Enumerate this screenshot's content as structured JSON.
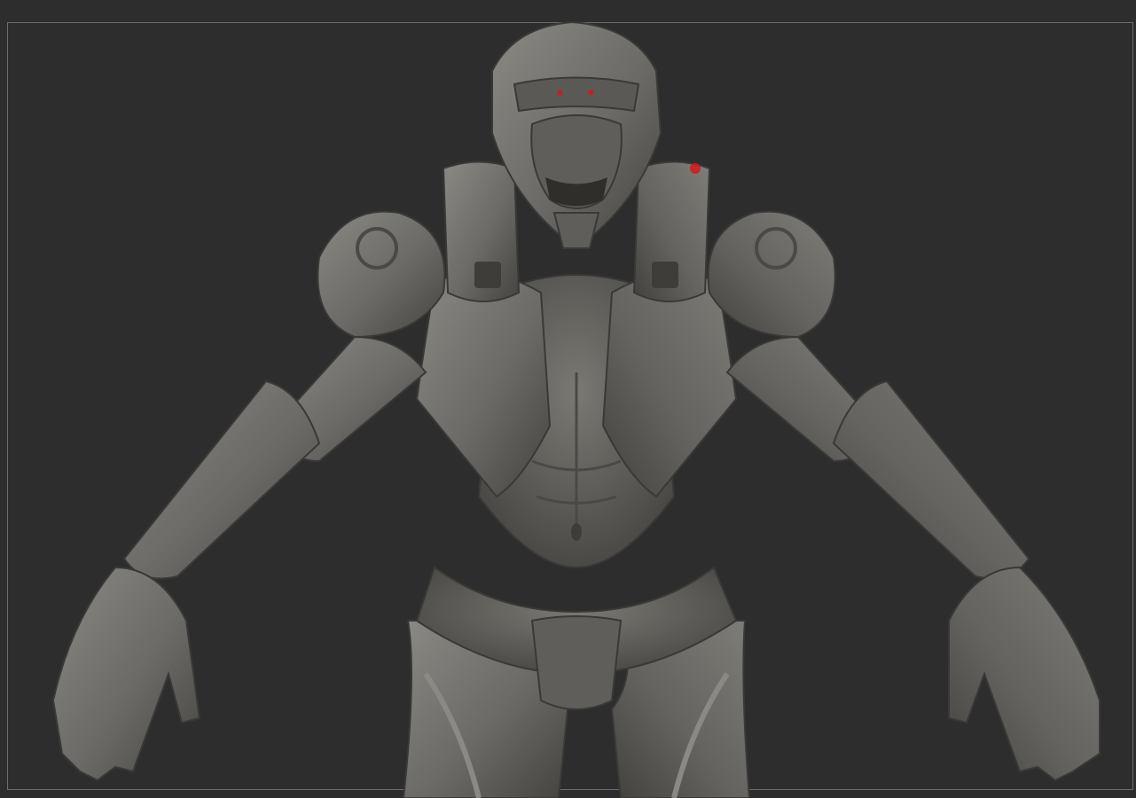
{
  "viewport": {
    "background_color": "#2d2d2d",
    "frame_border_color": "#6c6c6c"
  },
  "model": {
    "material_color": "#6b6a66",
    "highlight_color": "#8a8984",
    "shadow_color": "#3e3d3a",
    "marker_color": "#d11a1a"
  }
}
